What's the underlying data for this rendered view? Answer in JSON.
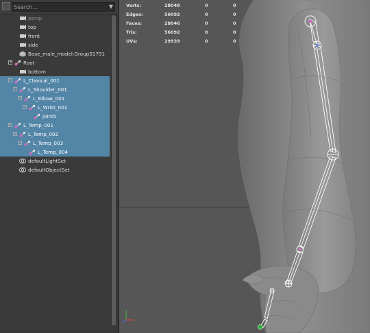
{
  "outliner": {
    "search": {
      "placeholder": "Search..."
    },
    "items": [
      {
        "label": "persp",
        "icon": "camera-icon",
        "dim": true,
        "selected": false
      },
      {
        "label": "top",
        "icon": "camera-icon",
        "dim": false,
        "selected": false
      },
      {
        "label": "front",
        "icon": "camera-icon",
        "dim": false,
        "selected": false
      },
      {
        "label": "side",
        "icon": "camera-icon",
        "dim": false,
        "selected": false
      },
      {
        "label": "Base_male_model:Group51791",
        "icon": "mesh-icon",
        "dim": false,
        "selected": false
      },
      {
        "label": "Root",
        "icon": "joint-icon",
        "dim": false,
        "selected": false,
        "expand": "+"
      },
      {
        "label": "bottom",
        "icon": "camera-icon",
        "dim": false,
        "selected": false
      },
      {
        "label": "L_Clavical_001",
        "icon": "joint-icon",
        "dim": false,
        "selected": true,
        "expand": "-"
      },
      {
        "label": "L_Shoulder_001",
        "icon": "joint-icon",
        "dim": false,
        "selected": true,
        "expand": "-"
      },
      {
        "label": "L_Elbow_001",
        "icon": "joint-icon",
        "dim": false,
        "selected": true,
        "expand": "-"
      },
      {
        "label": "L_Wrist_001",
        "icon": "joint-icon",
        "dim": false,
        "selected": true,
        "expand": "-"
      },
      {
        "label": "joint5",
        "icon": "joint-icon",
        "dim": false,
        "selected": true
      },
      {
        "label": "L_Temp_001",
        "icon": "joint-icon",
        "dim": false,
        "selected": true,
        "expand": "-"
      },
      {
        "label": "L_Temp_002",
        "icon": "joint-icon",
        "dim": false,
        "selected": true,
        "expand": "-"
      },
      {
        "label": "L_Temp_003",
        "icon": "joint-icon",
        "dim": false,
        "selected": true,
        "expand": "-"
      },
      {
        "label": "L_Temp_004",
        "icon": "joint-icon",
        "dim": false,
        "selected": true
      },
      {
        "label": "defaultLightSet",
        "icon": "set-icon",
        "dim": false,
        "selected": false
      },
      {
        "label": "defaultObjectSet",
        "icon": "set-icon",
        "dim": false,
        "selected": false
      }
    ]
  },
  "hud": {
    "rows": [
      {
        "name": "Verts:",
        "v1": "28048",
        "v2": "0",
        "v3": "0"
      },
      {
        "name": "Edges:",
        "v1": "56092",
        "v2": "0",
        "v3": "0"
      },
      {
        "name": "Faces:",
        "v1": "28046",
        "v2": "0",
        "v3": "0"
      },
      {
        "name": "Tris:",
        "v1": "56092",
        "v2": "0",
        "v3": "0"
      },
      {
        "name": "UVs:",
        "v1": "29939",
        "v2": "0",
        "v3": "0"
      }
    ]
  },
  "colors": {
    "selection": "#5285a6",
    "mesh": "#8c8c8c",
    "bone": "#ffffff",
    "joint_pink": "#d070c0",
    "joint_blue": "#6a8ad8",
    "root_green": "#2fae3a"
  }
}
